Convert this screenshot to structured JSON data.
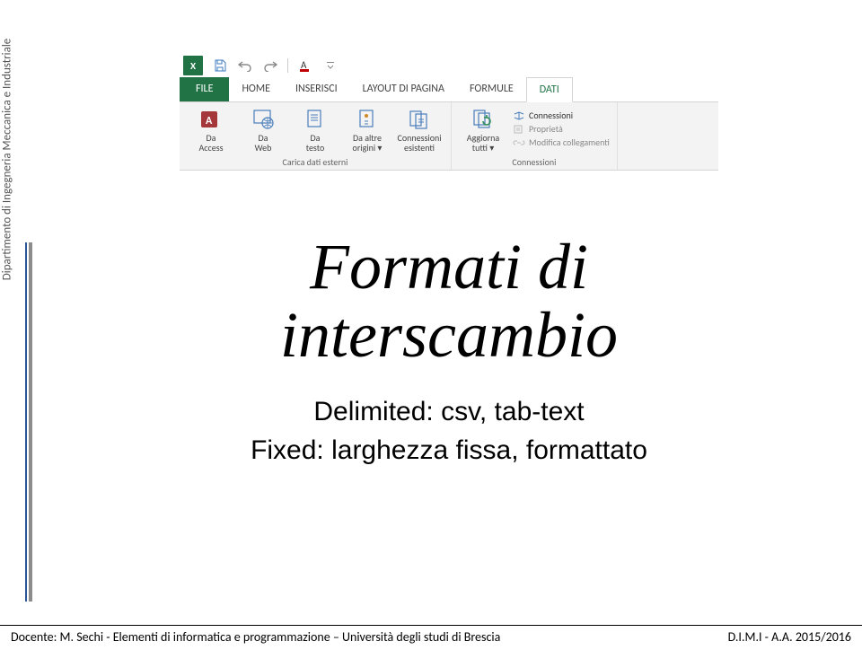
{
  "sidebar": {
    "department": "Dipartimento di Ingegneria Meccanica e Industriale"
  },
  "qat": {
    "logo": "X"
  },
  "ribbon": {
    "tabs": {
      "file": "FILE",
      "home": "HOME",
      "insert": "INSERISCI",
      "layout": "LAYOUT DI PAGINA",
      "formulas": "FORMULE",
      "data": "DATI"
    },
    "groups": {
      "external": {
        "access": "Da\nAccess",
        "web": "Da\nWeb",
        "text": "Da\ntesto",
        "other": "Da altre\norigini ▾",
        "existing": "Connessioni\nesistenti",
        "label": "Carica dati esterni"
      },
      "connections": {
        "refresh": "Aggiorna\ntutti ▾",
        "connections": "Connessioni",
        "properties": "Proprietà",
        "edit_links": "Modifica collegamenti",
        "label": "Connessioni"
      }
    }
  },
  "slide": {
    "title1": "Formati di",
    "title2": "interscambio",
    "body1": "Delimited: csv, tab-text",
    "body2": "Fixed: larghezza fissa, formattato"
  },
  "footer": {
    "left": "Docente: M. Sechi  - Elementi di informatica e programmazione – Università degli studi di Brescia",
    "right": "D.I.M.I - A.A. 2015/2016"
  }
}
